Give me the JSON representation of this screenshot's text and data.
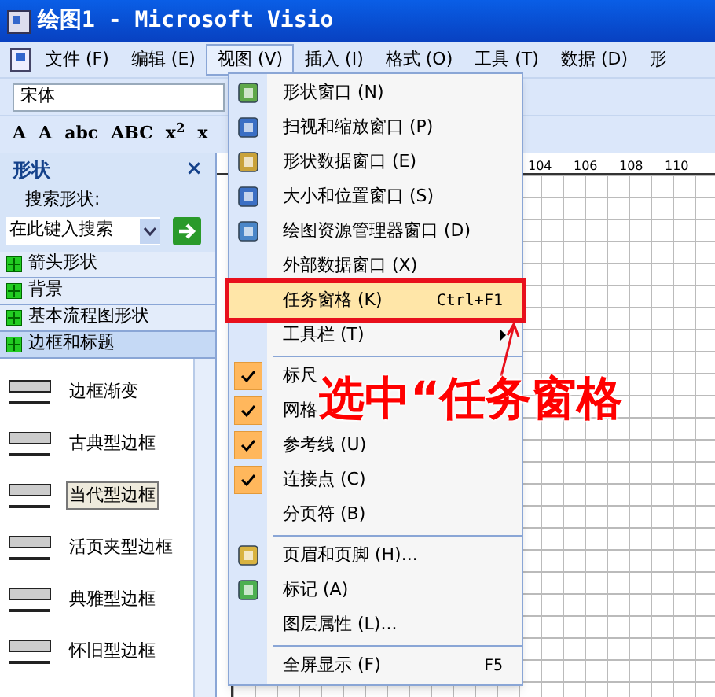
{
  "window": {
    "title": "绘图1 - Microsoft Visio"
  },
  "menu_bar": [
    {
      "label": "文件 (F)",
      "selected": false
    },
    {
      "label": "编辑 (E)",
      "selected": false
    },
    {
      "label": "视图 (V)",
      "selected": true
    },
    {
      "label": "插入 (I)",
      "selected": false
    },
    {
      "label": "格式 (O)",
      "selected": false
    },
    {
      "label": "工具 (T)",
      "selected": false
    },
    {
      "label": "数据 (D)",
      "selected": false
    },
    {
      "label": "形",
      "selected": false
    }
  ],
  "font_box": {
    "value": "宋体"
  },
  "format_buttons": [
    "A",
    "A",
    "abc",
    "ABC",
    "x$^{2}$",
    "x"
  ],
  "ruler": [
    "104",
    "106",
    "108",
    "110"
  ],
  "shapes_panel": {
    "title": "形状",
    "close": "×",
    "search_label": "搜索形状:",
    "search_placeholder": "在此键入搜索",
    "stencils": [
      {
        "label": "箭头形状",
        "selected": false
      },
      {
        "label": "背景",
        "selected": false
      },
      {
        "label": "基本流程图形状",
        "selected": false
      },
      {
        "label": "边框和标题",
        "selected": true
      }
    ],
    "shapes": [
      {
        "label": "边框渐变",
        "selected": false
      },
      {
        "label": "古典型边框",
        "selected": false
      },
      {
        "label": "当代型边框",
        "selected": true
      },
      {
        "label": "活页夹型边框",
        "selected": false
      },
      {
        "label": "典雅型边框",
        "selected": false
      },
      {
        "label": "怀旧型边框",
        "selected": false
      }
    ]
  },
  "view_menu": [
    {
      "kind": "item",
      "label": "形状窗口 (N)",
      "checked": false,
      "selected": false
    },
    {
      "kind": "item",
      "label": "扫视和缩放窗口 (P)",
      "checked": false,
      "selected": false
    },
    {
      "kind": "item",
      "label": "形状数据窗口 (E)",
      "checked": false,
      "selected": false
    },
    {
      "kind": "item",
      "label": "大小和位置窗口 (S)",
      "checked": false,
      "selected": false
    },
    {
      "kind": "item",
      "label": "绘图资源管理器窗口 (D)",
      "checked": false,
      "selected": false
    },
    {
      "kind": "item",
      "label": "外部数据窗口 (X)",
      "checked": false,
      "selected": false
    },
    {
      "kind": "item",
      "label": "任务窗格 (K)",
      "shortcut": "Ctrl+F1",
      "checked": false,
      "selected": true
    },
    {
      "kind": "submenu",
      "label": "工具栏 (T)",
      "checked": false,
      "selected": false
    },
    {
      "kind": "separator"
    },
    {
      "kind": "item",
      "label": "标尺",
      "checked": true,
      "selected": false
    },
    {
      "kind": "item",
      "label": "网格",
      "checked": true,
      "selected": false
    },
    {
      "kind": "item",
      "label": "参考线 (U)",
      "checked": true,
      "selected": false
    },
    {
      "kind": "item",
      "label": "连接点 (C)",
      "checked": true,
      "selected": false
    },
    {
      "kind": "item",
      "label": "分页符 (B)",
      "checked": false,
      "selected": false
    },
    {
      "kind": "separator"
    },
    {
      "kind": "item",
      "label": "页眉和页脚 (H)...",
      "checked": false,
      "selected": false
    },
    {
      "kind": "item",
      "label": "标记 (A)",
      "checked": false,
      "selected": false
    },
    {
      "kind": "item",
      "label": "图层属性 (L)...",
      "checked": false,
      "selected": false
    },
    {
      "kind": "separator"
    },
    {
      "kind": "item",
      "label": "全屏显示 (F)",
      "shortcut": "F5",
      "checked": false,
      "selected": false
    }
  ],
  "annotation": {
    "text": "选中“任务窗格"
  }
}
